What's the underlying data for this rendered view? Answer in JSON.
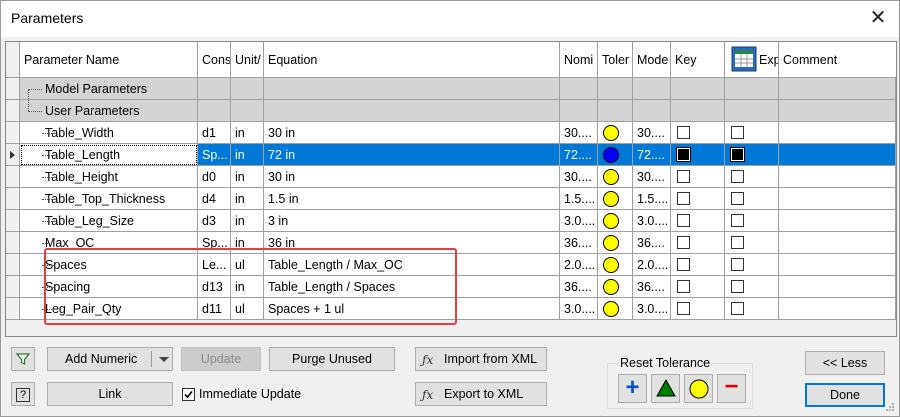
{
  "window": {
    "title": "Parameters",
    "close_glyph": "✕"
  },
  "columns": [
    "Parameter Name",
    "Cons",
    "Unit/",
    "Equation",
    "Nomi",
    "Toler",
    "Mode",
    "Key",
    "Exp",
    "Comment"
  ],
  "groups": {
    "model": "Model Parameters",
    "user": "User Parameters"
  },
  "rows": [
    {
      "name": "Table_Width",
      "cons": "d1",
      "unit": "in",
      "equation": "30 in",
      "nominal": "30....",
      "model": "30....",
      "key": false,
      "export": false,
      "selected": false
    },
    {
      "name": "Table_Length",
      "cons": "Sp...",
      "unit": "in",
      "equation": "72 in",
      "nominal": "72....",
      "model": "72....",
      "key": true,
      "export": true,
      "selected": true
    },
    {
      "name": "Table_Height",
      "cons": "d0",
      "unit": "in",
      "equation": "30 in",
      "nominal": "30....",
      "model": "30....",
      "key": false,
      "export": false,
      "selected": false
    },
    {
      "name": "Table_Top_Thickness",
      "cons": "d4",
      "unit": "in",
      "equation": "1.5 in",
      "nominal": "1.5....",
      "model": "1.5....",
      "key": false,
      "export": false,
      "selected": false
    },
    {
      "name": "Table_Leg_Size",
      "cons": "d3",
      "unit": "in",
      "equation": "3 in",
      "nominal": "3.0....",
      "model": "3.0....",
      "key": false,
      "export": false,
      "selected": false
    },
    {
      "name": "Max_OC",
      "cons": "Sp...",
      "unit": "in",
      "equation": "36 in",
      "nominal": "36....",
      "model": "36....",
      "key": false,
      "export": false,
      "selected": false
    },
    {
      "name": "Spaces",
      "cons": "Le...",
      "unit": "ul",
      "equation": "Table_Length / Max_OC",
      "nominal": "2.0....",
      "model": "2.0....",
      "key": false,
      "export": false,
      "selected": false
    },
    {
      "name": "Spacing",
      "cons": "d13",
      "unit": "in",
      "equation": "Table_Length / Spaces",
      "nominal": "36....",
      "model": "36....",
      "key": false,
      "export": false,
      "selected": false
    },
    {
      "name": "Leg_Pair_Qty",
      "cons": "d11",
      "unit": "ul",
      "equation": "Spaces + 1 ul",
      "nominal": "3.0....",
      "model": "3.0....",
      "key": false,
      "export": false,
      "selected": false
    }
  ],
  "buttons": {
    "add_numeric": "Add Numeric",
    "update": "Update",
    "purge_unused": "Purge Unused",
    "import_xml": "Import from XML",
    "export_xml": "Export to XML",
    "link": "Link",
    "immediate_update": "Immediate Update",
    "less": "<< Less",
    "done": "Done"
  },
  "reset_tolerance": {
    "label": "Reset Tolerance",
    "plus": "+",
    "minus": "−"
  },
  "icons": {
    "filter": "filter-icon",
    "help": "help-icon",
    "fx": "fx-icon",
    "excel": "excel-export-icon"
  },
  "colors": {
    "selection": "#0078d7",
    "highlight_box": "#e04040",
    "tol_yellow": "#ffff00",
    "tol_blue": "#0000ff",
    "green_tri": "#008000",
    "red_minus": "#e00000",
    "blue_plus": "#0050d0"
  }
}
